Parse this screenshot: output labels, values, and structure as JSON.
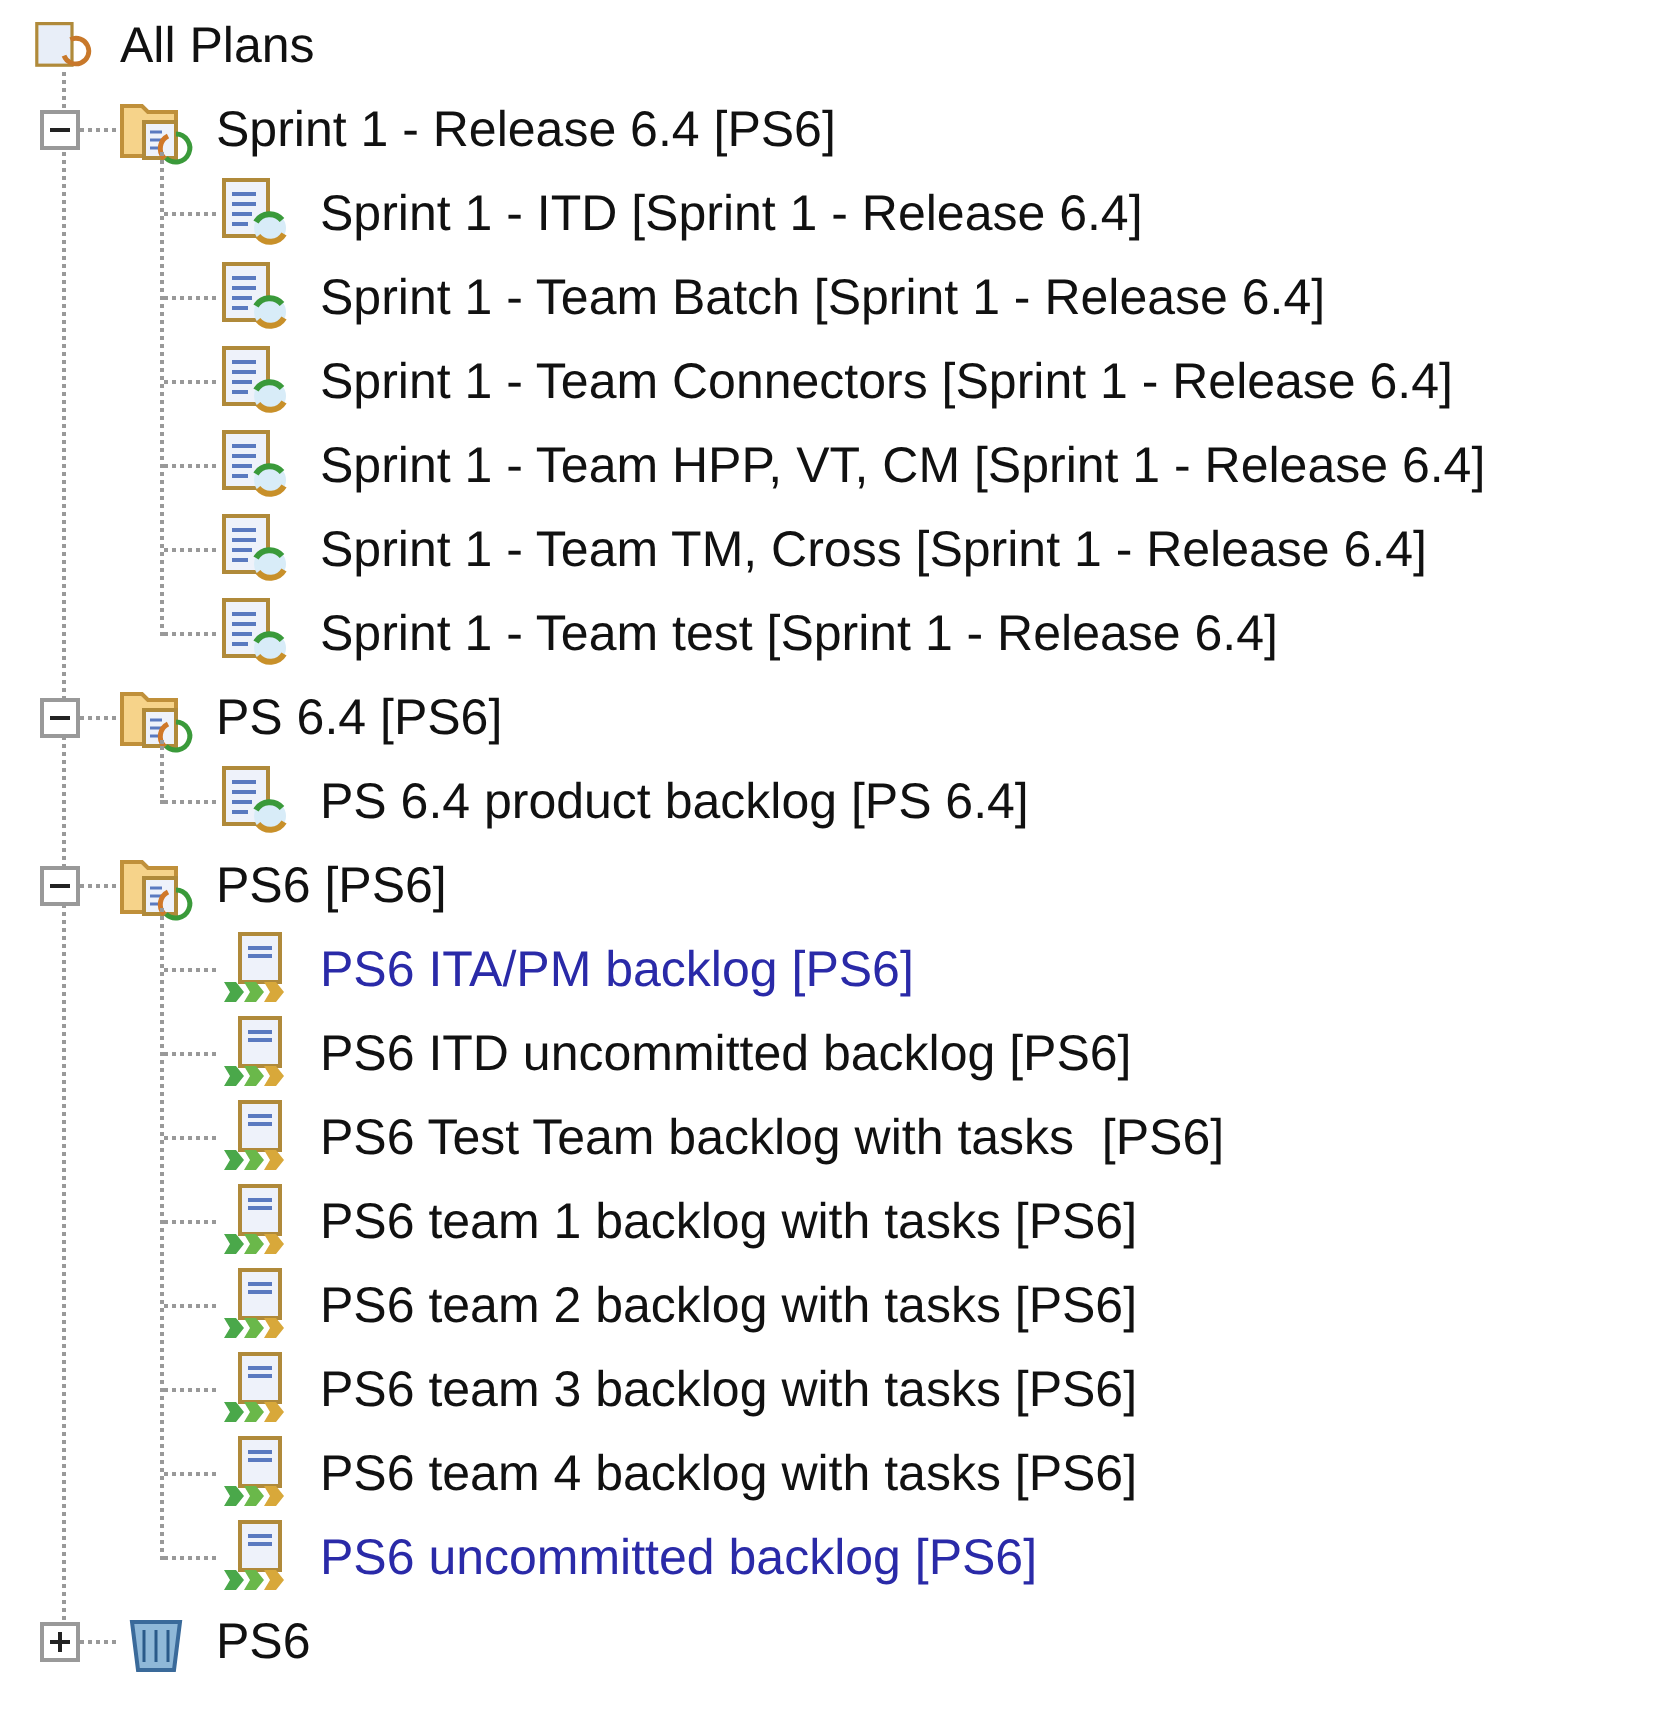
{
  "tree": {
    "label": "All Plans",
    "kind": "plans",
    "children": [
      {
        "label": "Sprint 1 - Release 6.4 [PS6]",
        "kind": "folder",
        "expanded": true,
        "children": [
          {
            "label": "Sprint 1 - ITD [Sprint 1 - Release 6.4]",
            "kind": "plan",
            "highlighted": false
          },
          {
            "label": "Sprint 1 - Team Batch [Sprint 1 - Release 6.4]",
            "kind": "plan",
            "highlighted": false
          },
          {
            "label": "Sprint 1 - Team Connectors [Sprint 1 - Release 6.4]",
            "kind": "plan",
            "highlighted": false
          },
          {
            "label": "Sprint 1 - Team HPP, VT, CM [Sprint 1 - Release 6.4]",
            "kind": "plan",
            "highlighted": false
          },
          {
            "label": "Sprint 1 - Team TM, Cross [Sprint 1 - Release 6.4]",
            "kind": "plan",
            "highlighted": false
          },
          {
            "label": "Sprint 1 - Team test [Sprint 1 - Release 6.4]",
            "kind": "plan",
            "highlighted": false
          }
        ]
      },
      {
        "label": "PS 6.4 [PS6]",
        "kind": "folder",
        "expanded": true,
        "children": [
          {
            "label": "PS 6.4 product backlog [PS 6.4]",
            "kind": "plan",
            "highlighted": false
          }
        ]
      },
      {
        "label": "PS6 [PS6]",
        "kind": "folder",
        "expanded": true,
        "children": [
          {
            "label": "PS6 ITA/PM backlog [PS6]",
            "kind": "backlog",
            "highlighted": true
          },
          {
            "label": "PS6 ITD uncommitted backlog [PS6]",
            "kind": "backlog",
            "highlighted": false
          },
          {
            "label": "PS6 Test Team backlog with tasks  [PS6]",
            "kind": "backlog",
            "highlighted": false
          },
          {
            "label": "PS6 team 1 backlog with tasks [PS6]",
            "kind": "backlog",
            "highlighted": false
          },
          {
            "label": "PS6 team 2 backlog with tasks [PS6]",
            "kind": "backlog",
            "highlighted": false
          },
          {
            "label": "PS6 team 3 backlog with tasks [PS6]",
            "kind": "backlog",
            "highlighted": false
          },
          {
            "label": "PS6 team 4 backlog with tasks [PS6]",
            "kind": "backlog",
            "highlighted": false
          },
          {
            "label": "PS6 uncommitted backlog [PS6]",
            "kind": "backlog",
            "highlighted": true
          }
        ]
      },
      {
        "label": "PS6",
        "kind": "bin",
        "expanded": false
      }
    ]
  }
}
